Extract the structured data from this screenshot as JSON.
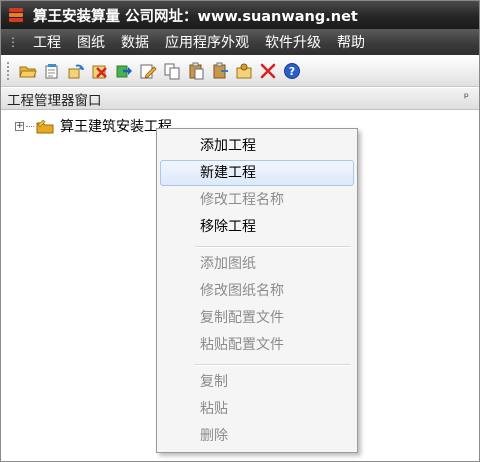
{
  "window": {
    "title": "算王安装算量 公司网址：www.suanwang.net"
  },
  "menubar": {
    "grip": "⋮",
    "items": [
      "工程",
      "图纸",
      "数据",
      "应用程序外观",
      "软件升级",
      "帮助"
    ]
  },
  "toolbar": {
    "buttons": [
      {
        "icon": "open-folder-icon"
      },
      {
        "icon": "new-project-icon"
      },
      {
        "icon": "refresh-icon"
      },
      {
        "icon": "delete-project-icon"
      },
      {
        "icon": "export-icon"
      },
      {
        "icon": "edit-icon"
      },
      {
        "icon": "copy-icon"
      },
      {
        "icon": "paste-icon"
      },
      {
        "icon": "clipboard-icon"
      },
      {
        "icon": "config-icon"
      },
      {
        "icon": "close-x-icon"
      },
      {
        "icon": "help-icon"
      }
    ]
  },
  "panel": {
    "title": "工程管理器窗口",
    "pin": "ᵖ"
  },
  "tree": {
    "expander": "+",
    "root_label": "算王建筑安装工程"
  },
  "context_menu": {
    "items": [
      {
        "label": "添加工程",
        "enabled": true
      },
      {
        "label": "新建工程",
        "enabled": true,
        "highlighted": true
      },
      {
        "label": "修改工程名称",
        "enabled": false
      },
      {
        "label": "移除工程",
        "enabled": true
      },
      {
        "label": "添加图纸",
        "enabled": false
      },
      {
        "label": "修改图纸名称",
        "enabled": false
      },
      {
        "label": "复制配置文件",
        "enabled": false
      },
      {
        "label": "粘贴配置文件",
        "enabled": false
      },
      {
        "label": "复制",
        "enabled": false
      },
      {
        "label": "粘贴",
        "enabled": false
      },
      {
        "label": "删除",
        "enabled": false
      }
    ]
  },
  "colors": {
    "titlebar": "#262626",
    "menubar": "#3a3a3a",
    "highlight": "#dde9f9",
    "disabled_text": "#8c8c8c",
    "delete_red": "#d62222",
    "help_blue": "#2b5fc8"
  }
}
